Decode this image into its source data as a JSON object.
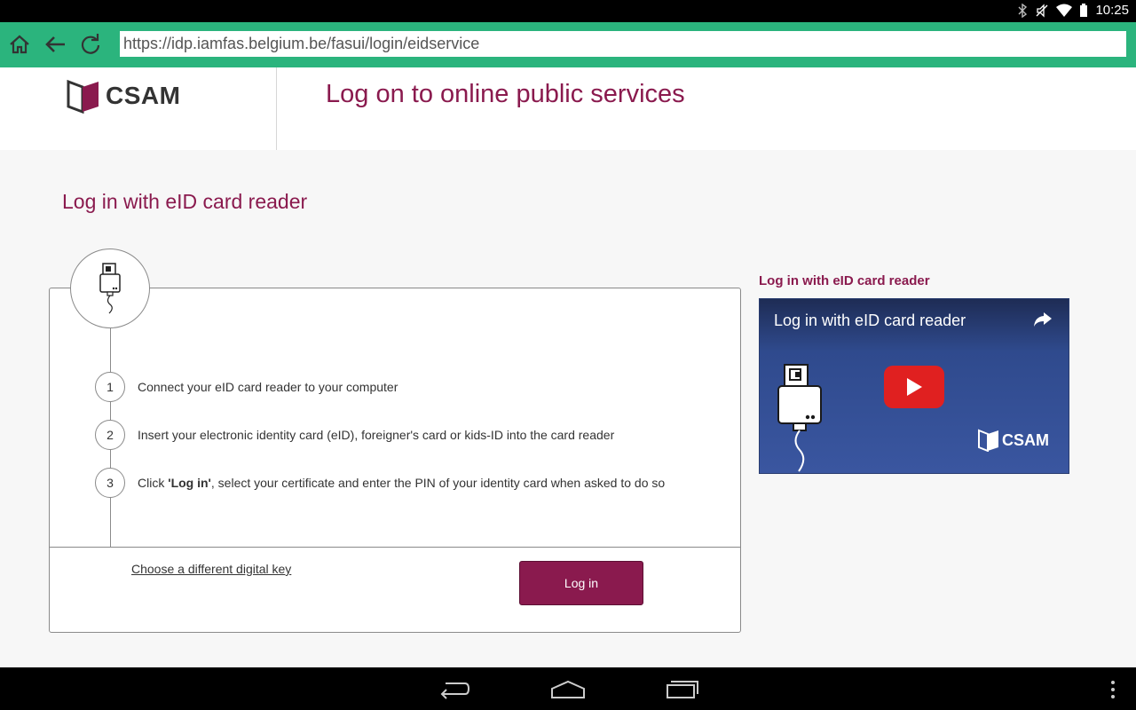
{
  "status_bar": {
    "time": "10:25"
  },
  "browser": {
    "url": "https://idp.iamfas.belgium.be/fasui/login/eidservice"
  },
  "header": {
    "logo_text": "CSAM",
    "title": "Log on to online public services"
  },
  "main": {
    "section_title": "Log in with eID card reader",
    "steps": [
      {
        "num": "1",
        "text": "Connect your eID card reader to your computer"
      },
      {
        "num": "2",
        "text": "Insert your electronic identity card (eID), foreigner's card or kids-ID into the card reader"
      },
      {
        "num": "3",
        "text_pre": "Click ",
        "text_bold": "'Log in'",
        "text_post": ", select your certificate and enter the PIN of your identity card when asked to do so"
      }
    ],
    "alt_link": "Choose a different digital key",
    "login_button": "Log in"
  },
  "video": {
    "heading": "Log in with eID card reader",
    "overlay_title": "Log in with eID card reader",
    "logo_text": "CSAM"
  },
  "colors": {
    "accent": "#8a1a4e",
    "browser_bar": "#2bb47d"
  }
}
